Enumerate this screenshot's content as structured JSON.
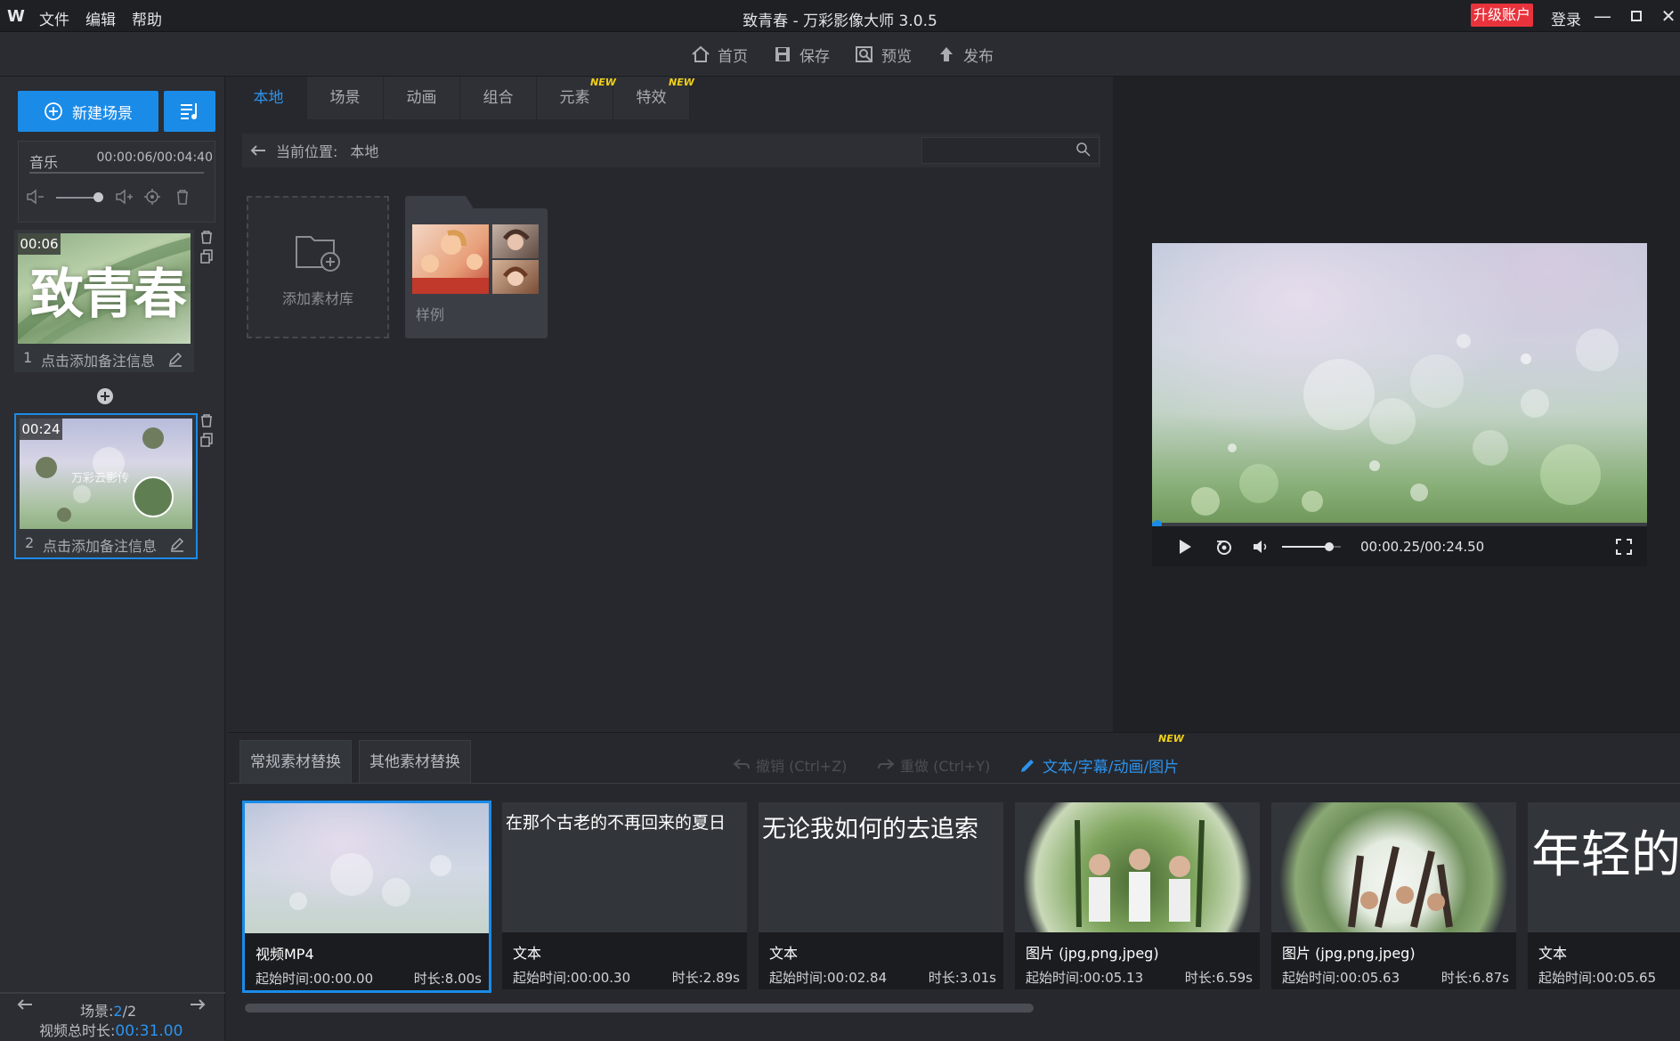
{
  "titlebar": {
    "logo": "W",
    "menu": [
      "文件",
      "编辑",
      "帮助"
    ],
    "title": "致青春 - 万彩影像大师 3.0.5",
    "upgrade": "升级账户",
    "login": "登录"
  },
  "toolbar": {
    "home": "首页",
    "save": "保存",
    "preview": "预览",
    "publish": "发布"
  },
  "left": {
    "new_scene": "新建场景",
    "music": {
      "label": "音乐",
      "time": "00:00:06/00:04:40"
    },
    "scenes": [
      {
        "time": "00:06",
        "index": "1",
        "note": "点击添加备注信息",
        "thumb_text": "致青春"
      },
      {
        "time": "00:24",
        "index": "2",
        "note": "点击添加备注信息",
        "thumb_text": "万彩云影传"
      }
    ],
    "footer": {
      "scene_label": "场景:",
      "scene_current": "2",
      "scene_total": "/2",
      "duration_label": "视频总时长:",
      "duration": "00:31.00"
    }
  },
  "library": {
    "tabs": [
      {
        "label": "本地",
        "active": true,
        "new": ""
      },
      {
        "label": "场景",
        "active": false,
        "new": ""
      },
      {
        "label": "动画",
        "active": false,
        "new": ""
      },
      {
        "label": "组合",
        "active": false,
        "new": ""
      },
      {
        "label": "元素",
        "active": false,
        "new": "NEW"
      },
      {
        "label": "特效",
        "active": false,
        "new": "NEW"
      }
    ],
    "location_label": "当前位置:",
    "location_value": "本地",
    "search_placeholder": "",
    "add_library": "添加素材库",
    "sample_folder": "样例"
  },
  "preview": {
    "time": "00:00.25/00:24.50",
    "progress": 0.01,
    "volume": 0.8
  },
  "bottom": {
    "tabs": [
      "常规素材替换",
      "其他素材替换"
    ],
    "undo": "撤销 (Ctrl+Z)",
    "redo": "重做 (Ctrl+Y)",
    "edit_link": "文本/字幕/动画/图片",
    "edit_new": "NEW",
    "items": [
      {
        "type": "视频MP4",
        "start": "起始时间:00:00.00",
        "duration": "时长:8.00s",
        "text": ""
      },
      {
        "type": "文本",
        "start": "起始时间:00:00.30",
        "duration": "时长:2.89s",
        "text": "在那个古老的不再回来的夏日"
      },
      {
        "type": "文本",
        "start": "起始时间:00:02.84",
        "duration": "时长:3.01s",
        "text": "无论我如何的去追索"
      },
      {
        "type": "图片 (jpg,png,jpeg)",
        "start": "起始时间:00:05.13",
        "duration": "时长:6.59s",
        "text": ""
      },
      {
        "type": "图片 (jpg,png,jpeg)",
        "start": "起始时间:00:05.63",
        "duration": "时长:6.87s",
        "text": ""
      },
      {
        "type": "文本",
        "start": "起始时间:00:05.65",
        "duration": "",
        "text": "年轻的"
      }
    ]
  }
}
